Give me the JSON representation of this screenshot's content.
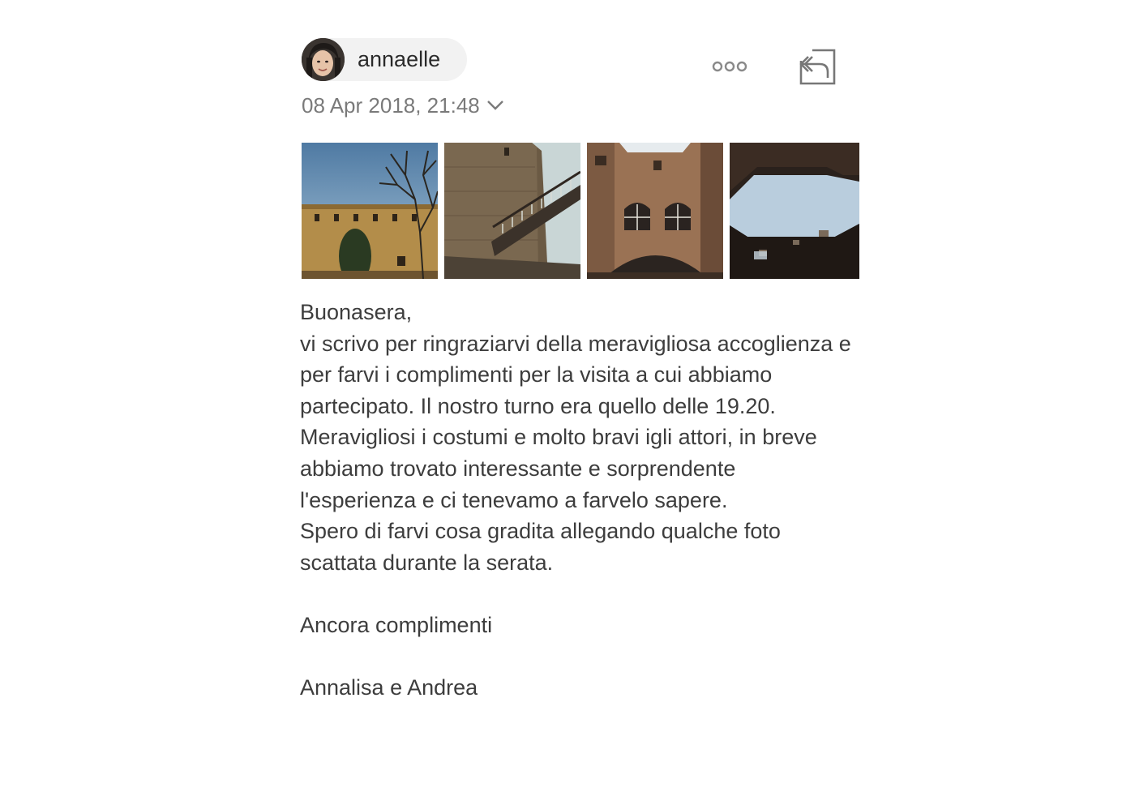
{
  "sender": {
    "name": "annaelle",
    "avatar_icon": "user-photo-avatar"
  },
  "header": {
    "date": "08 Apr 2018, 21:48",
    "more_icon": "more-horizontal-icon",
    "reply_icon": "reply-icon",
    "chevron_icon": "chevron-down-icon"
  },
  "attachments": [
    {
      "label": "castle-wall-with-tree-photo"
    },
    {
      "label": "tower-with-bridge-photo"
    },
    {
      "label": "courtyard-brick-windows-photo"
    },
    {
      "label": "courtyard-sky-opening-photo"
    }
  ],
  "message": {
    "greeting": "Buonasera,",
    "paragraph1": "vi scrivo per ringraziarvi della meravigliosa accoglienza e per farvi i complimenti per la visita a cui abbiamo partecipato. Il nostro turno era quello delle 19.20.",
    "paragraph2": "Meravigliosi i costumi e molto bravi igli attori, in breve abbiamo trovato interessante e sorprendente l'esperienza e ci tenevamo a farvelo sapere.",
    "paragraph3": "Spero di farvi cosa gradita allegando qualche foto scattata durante la serata.",
    "closing": "Ancora complimenti",
    "signature": "Annalisa e Andrea"
  }
}
